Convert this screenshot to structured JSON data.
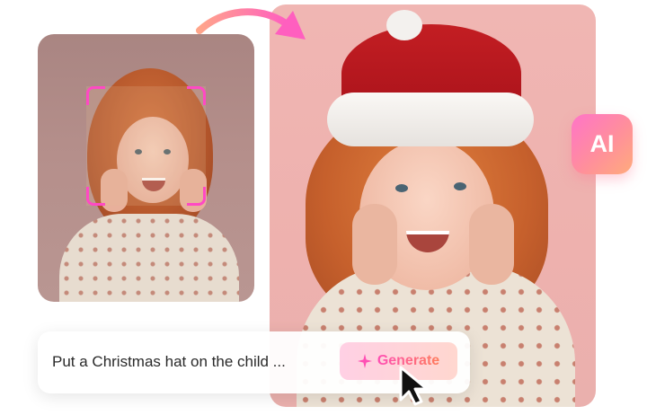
{
  "ai_badge": {
    "label": "AI"
  },
  "prompt": {
    "text": "Put a Christmas hat on the child ...",
    "button_label": "Generate"
  },
  "icons": {
    "arrow": "curved-arrow-icon",
    "sparkle": "sparkle-icon",
    "cursor": "pointer-cursor-icon"
  },
  "colors": {
    "accent_pink": "#ff49c4",
    "gradient_start": "#ff74c8",
    "gradient_end": "#ffab7c"
  }
}
